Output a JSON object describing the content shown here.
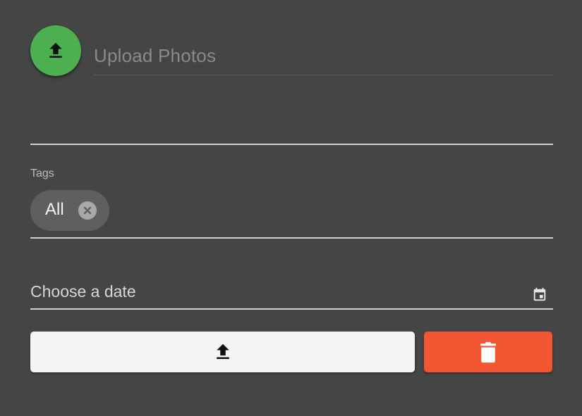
{
  "header": {
    "title": "Upload Photos",
    "upload_icon": "upload-icon"
  },
  "description": {
    "value": ""
  },
  "tags": {
    "label": "Tags",
    "chips": [
      {
        "label": "All",
        "remove_icon": "close-circle-icon"
      }
    ]
  },
  "date": {
    "placeholder": "Choose a date",
    "icon": "calendar-icon"
  },
  "actions": {
    "submit_icon": "upload-icon",
    "delete_icon": "trash-icon"
  },
  "colors": {
    "background": "#454545",
    "fab": "#4caf50",
    "submit_button": "#f4f4f4",
    "delete_button": "#f15532",
    "chip": "#5f5f5f"
  }
}
